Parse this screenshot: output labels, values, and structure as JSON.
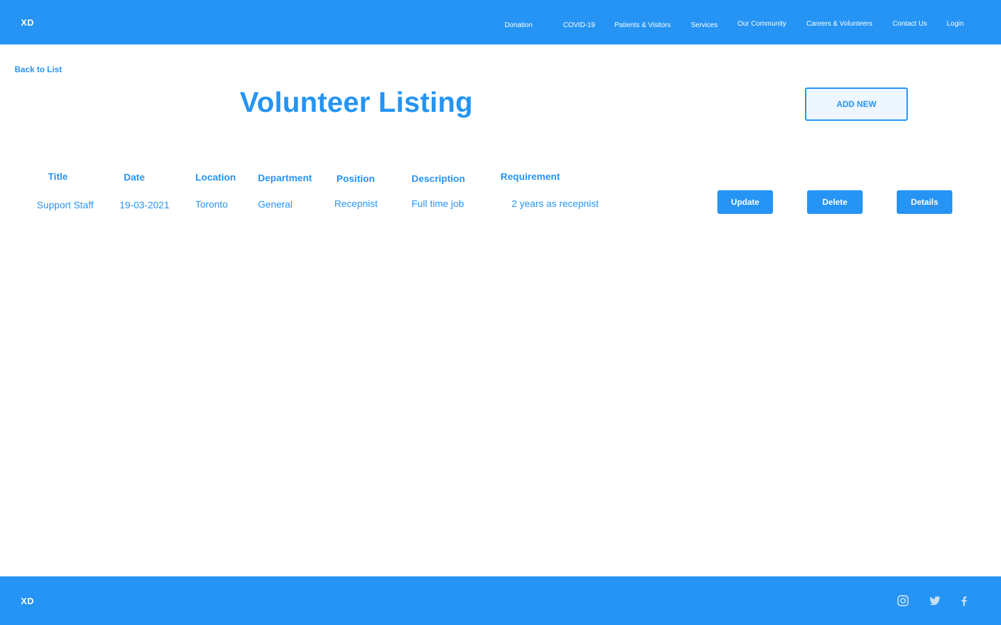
{
  "header": {
    "logo": "XD",
    "nav": [
      {
        "label": "Donation"
      },
      {
        "label": "COVID-19"
      },
      {
        "label": "Patients & Visitors"
      },
      {
        "label": "Services"
      },
      {
        "label": "Our Community"
      },
      {
        "label": "Careers & Volunteers"
      },
      {
        "label": "Contact Us"
      },
      {
        "label": "Login"
      }
    ]
  },
  "main": {
    "back_link": "Back to List",
    "title": "Volunteer Listing",
    "add_button": "ADD NEW",
    "table": {
      "headers": [
        "Title",
        "Date",
        "Location",
        "Department",
        "Position",
        "Description",
        "Requirement"
      ],
      "rows": [
        {
          "cells": [
            "Support Staff",
            "19-03-2021",
            "Toronto",
            "General",
            "Recepnist",
            "Full time job",
            "2 years as recepnist"
          ],
          "actions": [
            "Update",
            "Delete",
            "Details"
          ]
        }
      ]
    }
  },
  "footer": {
    "logo": "XD",
    "social_icons": [
      "instagram-icon",
      "twitter-icon",
      "facebook-icon"
    ]
  },
  "colors": {
    "brand": "#2594f4",
    "button_text": "#ffffff",
    "add_button_bg": "#eef6ff",
    "social_icon": "#c9dff3"
  }
}
